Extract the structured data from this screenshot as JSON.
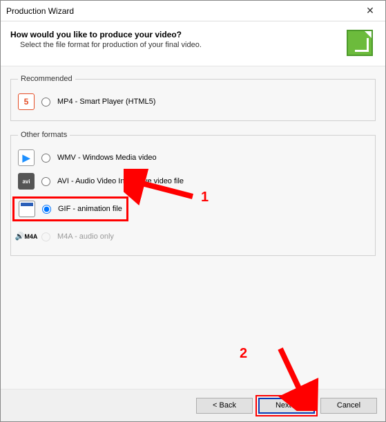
{
  "window": {
    "title": "Production Wizard"
  },
  "header": {
    "title": "How would you like to produce your video?",
    "sub": "Select the file format for production of your final video."
  },
  "groups": {
    "recommended": {
      "legend": "Recommended"
    },
    "other": {
      "legend": "Other formats"
    }
  },
  "options": {
    "mp4": {
      "label": "MP4 - Smart Player (HTML5)"
    },
    "wmv": {
      "label": "WMV - Windows Media video"
    },
    "avi": {
      "label": "AVI - Audio Video Interleave video file"
    },
    "gif": {
      "label": "GIF - animation file"
    },
    "m4a": {
      "label": "M4A - audio only",
      "icon_text": "M4A"
    }
  },
  "annotations": {
    "one": "1",
    "two": "2"
  },
  "buttons": {
    "back": "< Back",
    "next": "Next >",
    "cancel": "Cancel"
  },
  "icons": {
    "html5": "5",
    "wmv": "▶",
    "avi": "avi",
    "m4a_speaker": "🔊"
  }
}
